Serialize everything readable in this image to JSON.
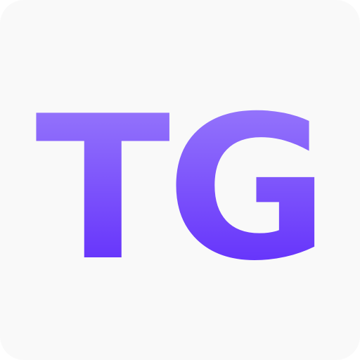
{
  "icon": {
    "monogram": "TG",
    "background_color": "#f9f9f9",
    "gradient_top_color": "#9e82fb",
    "gradient_bottom_color": "#5a23fb"
  }
}
